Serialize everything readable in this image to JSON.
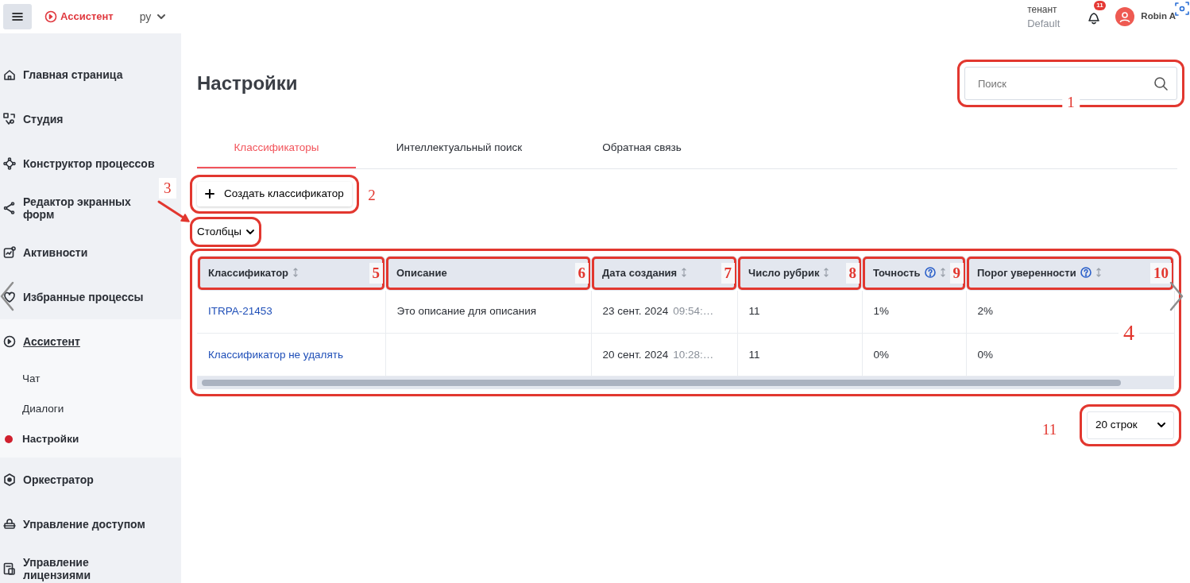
{
  "header": {
    "app_name": "Ассистент",
    "language": "ру",
    "tenant_label": "тенант",
    "tenant": "Default",
    "notifications": "11",
    "user": "Robin A"
  },
  "sidebar": {
    "items": [
      {
        "label": "Главная страница",
        "selected": false
      },
      {
        "label": "Студия",
        "selected": false
      },
      {
        "label": "Конструктор процессов",
        "selected": false
      },
      {
        "label": "Редактор экранных форм",
        "selected": false
      },
      {
        "label": "Активности",
        "selected": false
      },
      {
        "label": "Избранные процессы",
        "selected": false
      },
      {
        "label": "Ассистент",
        "selected": true,
        "children": [
          {
            "label": "Чат",
            "selected": false
          },
          {
            "label": "Диалоги",
            "selected": false
          },
          {
            "label": "Настройки",
            "selected": true
          }
        ]
      },
      {
        "label": "Оркестратор",
        "selected": false
      },
      {
        "label": "Управление доступом",
        "selected": false
      },
      {
        "label": "Управление лицензиями",
        "selected": false
      }
    ]
  },
  "page": {
    "title": "Настройки",
    "search": {
      "placeholder": "Поиск"
    },
    "tabs": [
      {
        "label": "Классификаторы",
        "selected": true
      },
      {
        "label": "Интеллектуальный поиск",
        "selected": false
      },
      {
        "label": "Обратная связь",
        "selected": false
      }
    ],
    "create_button": "Создать классификатор",
    "columns_toggle": "Столбцы",
    "table": {
      "columns": [
        {
          "label": "Классификатор",
          "sortable": true,
          "help": false
        },
        {
          "label": "Описание",
          "sortable": false,
          "help": false
        },
        {
          "label": "Дата создания",
          "sortable": true,
          "help": false
        },
        {
          "label": "Число рубрик",
          "sortable": true,
          "help": false
        },
        {
          "label": "Точность",
          "sortable": true,
          "help": true
        },
        {
          "label": "Порог уверенности",
          "sortable": true,
          "help": true
        }
      ],
      "rows": [
        {
          "name": "ITRPA-21453",
          "description": "Это описание для описания",
          "date": "23 сент. 2024",
          "time": "09:54:…",
          "rubrics": "11",
          "accuracy": "1%",
          "threshold": "2%"
        },
        {
          "name": "Классификатор не удалять",
          "date": "20 сент. 2024",
          "time": "10:28:…",
          "rubrics": "11",
          "accuracy": "0%",
          "threshold": "0%"
        }
      ]
    },
    "page_size": "20 строк"
  },
  "callouts": [
    {
      "number": "1"
    },
    {
      "number": "2"
    },
    {
      "number": "3"
    },
    {
      "number": "4"
    },
    {
      "number": "5"
    },
    {
      "number": "6"
    },
    {
      "number": "7"
    },
    {
      "number": "8"
    },
    {
      "number": "9"
    },
    {
      "number": "10"
    },
    {
      "number": "11"
    }
  ]
}
